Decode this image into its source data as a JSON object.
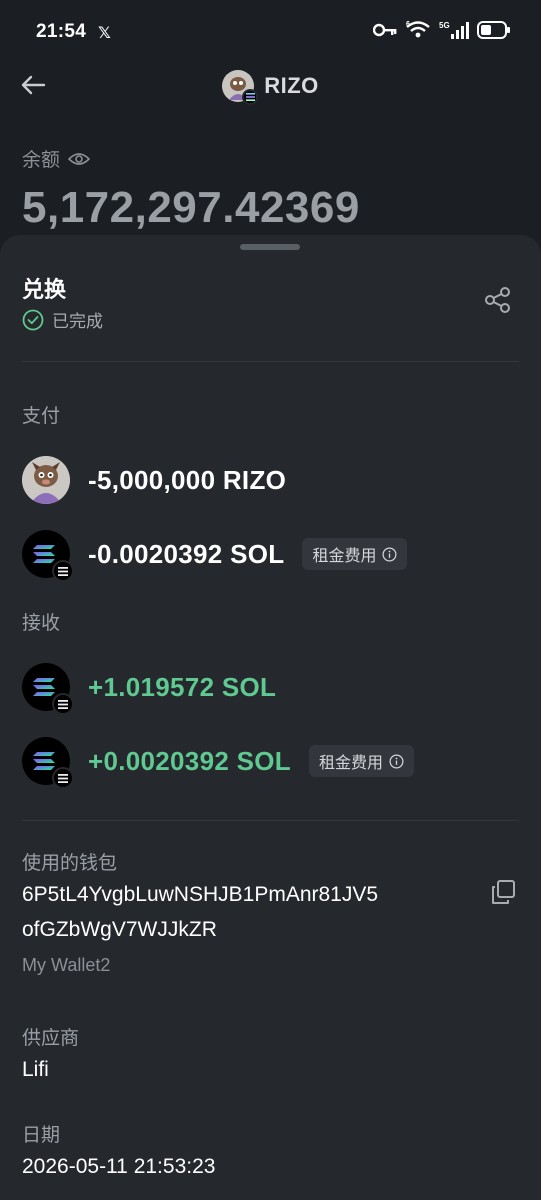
{
  "status_bar": {
    "time": "21:54",
    "x_glyph": "𝕏",
    "signal_label": "5G",
    "wifi_label": "6"
  },
  "header": {
    "title": "RIZO"
  },
  "balance": {
    "label": "余额",
    "value": "5,172,297.42369"
  },
  "swap": {
    "title": "兑换",
    "status": "已完成"
  },
  "pay": {
    "label": "支付",
    "items": [
      {
        "amount": "-5,000,000 RIZO",
        "icon": "rizo-token-icon"
      },
      {
        "amount": "-0.0020392 SOL",
        "icon": "sol-token-icon",
        "chip": "租金费用"
      }
    ]
  },
  "receive": {
    "label": "接收",
    "items": [
      {
        "amount": "+1.019572 SOL",
        "icon": "sol-token-icon"
      },
      {
        "amount": "+0.0020392 SOL",
        "icon": "sol-token-icon",
        "chip": "租金费用"
      }
    ]
  },
  "wallet": {
    "label": "使用的钱包",
    "address_line1": "6P5tL4YvgbLuwNSHJB1PmAnr81JV5",
    "address_line2": "ofGZbWgV7WJJkZR",
    "name": "My Wallet2"
  },
  "provider": {
    "label": "供应商",
    "value": "Lifi"
  },
  "date": {
    "label": "日期",
    "value": "2026-05-11 21:53:23"
  },
  "colors": {
    "background": "#1b1e22",
    "sheet": "#25282d",
    "positive": "#5fc991",
    "muted": "#9aa0a7"
  }
}
